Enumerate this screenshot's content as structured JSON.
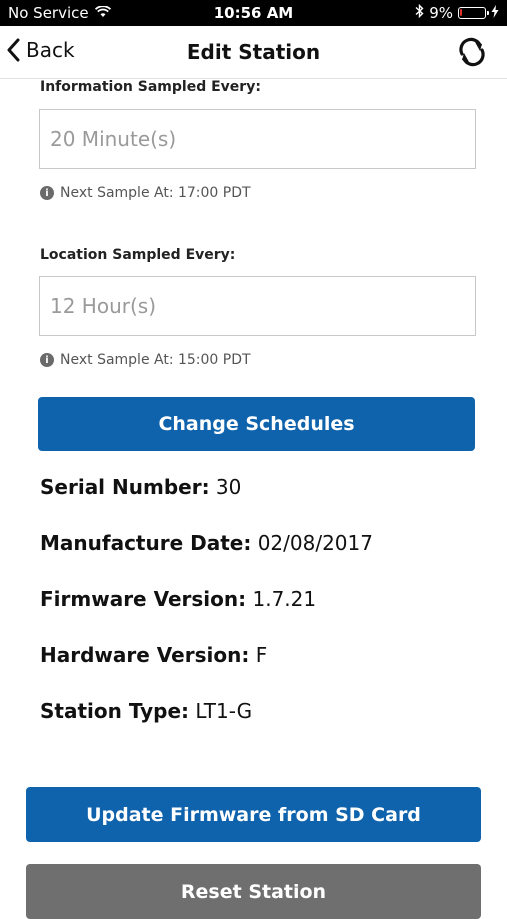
{
  "status_bar": {
    "carrier": "No Service",
    "time": "10:56 AM",
    "battery": "9%",
    "battery_level": 0.09
  },
  "nav": {
    "back_label": "Back",
    "title": "Edit Station"
  },
  "info_sampling": {
    "label": "Information Sampled Every:",
    "placeholder": "20 Minute(s)",
    "hint": "Next Sample At: 17:00 PDT"
  },
  "location_sampling": {
    "label": "Location Sampled Every:",
    "placeholder": "12 Hour(s)",
    "hint": "Next Sample At: 15:00 PDT"
  },
  "change_schedules_label": "Change Schedules",
  "details": {
    "serial_label": "Serial Number:",
    "serial_value": "30",
    "mfg_label": "Manufacture Date:",
    "mfg_value": "02/08/2017",
    "fw_label": "Firmware Version:",
    "fw_value": "1.7.21",
    "hw_label": "Hardware Version:",
    "hw_value": "F",
    "type_label": "Station Type:",
    "type_value": "LT1-G"
  },
  "update_firmware_label": "Update Firmware from SD Card",
  "reset_station_label": "Reset Station",
  "colors": {
    "primary": "#0f63ad",
    "secondary": "#6f6f6f",
    "battery_low": "#e0312b"
  }
}
